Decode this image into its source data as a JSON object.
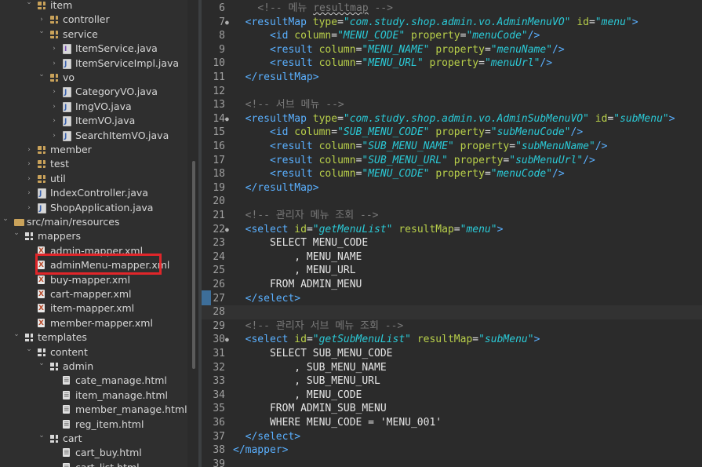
{
  "explorer": {
    "items": [
      {
        "label": "item",
        "icon": "package-icon",
        "depth": 3,
        "state": "expanded"
      },
      {
        "label": "controller",
        "icon": "package-icon",
        "depth": 4,
        "state": "collapsed"
      },
      {
        "label": "service",
        "icon": "package-icon",
        "depth": 4,
        "state": "expanded"
      },
      {
        "label": "ItemService.java",
        "icon": "java-interface-icon",
        "depth": 5,
        "state": "collapsed"
      },
      {
        "label": "ItemServiceImpl.java",
        "icon": "java-file-icon",
        "depth": 5,
        "state": "collapsed"
      },
      {
        "label": "vo",
        "icon": "package-icon",
        "depth": 4,
        "state": "expanded"
      },
      {
        "label": "CategoryVO.java",
        "icon": "java-file-icon",
        "depth": 5,
        "state": "collapsed"
      },
      {
        "label": "ImgVO.java",
        "icon": "java-file-icon",
        "depth": 5,
        "state": "collapsed"
      },
      {
        "label": "ItemVO.java",
        "icon": "java-file-icon",
        "depth": 5,
        "state": "collapsed"
      },
      {
        "label": "SearchItemVO.java",
        "icon": "java-file-icon",
        "depth": 5,
        "state": "collapsed"
      },
      {
        "label": "member",
        "icon": "package-icon",
        "depth": 3,
        "state": "collapsed"
      },
      {
        "label": "test",
        "icon": "package-icon",
        "depth": 3,
        "state": "collapsed"
      },
      {
        "label": "util",
        "icon": "package-icon",
        "depth": 3,
        "state": "collapsed"
      },
      {
        "label": "IndexController.java",
        "icon": "java-file-icon",
        "depth": 3,
        "state": "collapsed"
      },
      {
        "label": "ShopApplication.java",
        "icon": "java-file-icon",
        "depth": 3,
        "state": "collapsed"
      },
      {
        "label": "src/main/resources",
        "icon": "source-folder-icon",
        "depth": 1,
        "state": "expanded"
      },
      {
        "label": "mappers",
        "icon": "folder-icon",
        "depth": 2,
        "state": "expanded"
      },
      {
        "label": "admin-mapper.xml",
        "icon": "xml-file-icon",
        "depth": 3,
        "state": "leaf"
      },
      {
        "label": "adminMenu-mapper.xml",
        "icon": "xml-file-icon",
        "depth": 3,
        "state": "leaf",
        "highlighted": true
      },
      {
        "label": "buy-mapper.xml",
        "icon": "xml-file-icon",
        "depth": 3,
        "state": "leaf"
      },
      {
        "label": "cart-mapper.xml",
        "icon": "xml-file-icon",
        "depth": 3,
        "state": "leaf"
      },
      {
        "label": "item-mapper.xml",
        "icon": "xml-file-icon",
        "depth": 3,
        "state": "leaf"
      },
      {
        "label": "member-mapper.xml",
        "icon": "xml-file-icon",
        "depth": 3,
        "state": "leaf"
      },
      {
        "label": "templates",
        "icon": "folder-icon",
        "depth": 2,
        "state": "expanded"
      },
      {
        "label": "content",
        "icon": "folder-icon",
        "depth": 3,
        "state": "expanded"
      },
      {
        "label": "admin",
        "icon": "folder-icon",
        "depth": 4,
        "state": "expanded"
      },
      {
        "label": "cate_manage.html",
        "icon": "html-file-icon",
        "depth": 5,
        "state": "leaf"
      },
      {
        "label": "item_manage.html",
        "icon": "html-file-icon",
        "depth": 5,
        "state": "leaf"
      },
      {
        "label": "member_manage.html",
        "icon": "html-file-icon",
        "depth": 5,
        "state": "leaf"
      },
      {
        "label": "reg_item.html",
        "icon": "html-file-icon",
        "depth": 5,
        "state": "leaf"
      },
      {
        "label": "cart",
        "icon": "folder-icon",
        "depth": 4,
        "state": "expanded"
      },
      {
        "label": "cart_buy.html",
        "icon": "html-file-icon",
        "depth": 5,
        "state": "leaf"
      },
      {
        "label": "cart_list.html",
        "icon": "html-file-icon",
        "depth": 5,
        "state": "leaf"
      }
    ]
  },
  "editor": {
    "current_line": 28,
    "lines": [
      {
        "n": "6",
        "fold": "",
        "tokens": [
          [
            "    ",
            "txt"
          ],
          [
            "<!-- 메뉴 ",
            "com"
          ],
          [
            "resultmap",
            "com squig"
          ],
          [
            " -->",
            "com"
          ]
        ]
      },
      {
        "n": "7",
        "fold": "●",
        "tokens": [
          [
            "  ",
            "txt"
          ],
          [
            "<resultMap ",
            "tag"
          ],
          [
            "type",
            "attr"
          ],
          [
            "=",
            "txt"
          ],
          [
            "\"com.study.shop.admin.vo.AdminMenuVO\"",
            "str"
          ],
          [
            " ",
            "txt"
          ],
          [
            "id",
            "attr"
          ],
          [
            "=",
            "txt"
          ],
          [
            "\"menu\"",
            "str"
          ],
          [
            ">",
            "tag"
          ]
        ]
      },
      {
        "n": "8",
        "fold": "",
        "tokens": [
          [
            "      ",
            "txt"
          ],
          [
            "<id ",
            "tag"
          ],
          [
            "column",
            "attr"
          ],
          [
            "=",
            "txt"
          ],
          [
            "\"MENU_CODE\"",
            "str"
          ],
          [
            " ",
            "txt"
          ],
          [
            "property",
            "attr"
          ],
          [
            "=",
            "txt"
          ],
          [
            "\"menuCode\"",
            "str"
          ],
          [
            "/>",
            "tag"
          ]
        ]
      },
      {
        "n": "9",
        "fold": "",
        "tokens": [
          [
            "      ",
            "txt"
          ],
          [
            "<result ",
            "tag"
          ],
          [
            "column",
            "attr"
          ],
          [
            "=",
            "txt"
          ],
          [
            "\"MENU_NAME\"",
            "str"
          ],
          [
            " ",
            "txt"
          ],
          [
            "property",
            "attr"
          ],
          [
            "=",
            "txt"
          ],
          [
            "\"menuName\"",
            "str"
          ],
          [
            "/>",
            "tag"
          ]
        ]
      },
      {
        "n": "10",
        "fold": "",
        "tokens": [
          [
            "      ",
            "txt"
          ],
          [
            "<result ",
            "tag"
          ],
          [
            "column",
            "attr"
          ],
          [
            "=",
            "txt"
          ],
          [
            "\"MENU_URL\"",
            "str"
          ],
          [
            " ",
            "txt"
          ],
          [
            "property",
            "attr"
          ],
          [
            "=",
            "txt"
          ],
          [
            "\"menuUrl\"",
            "str"
          ],
          [
            "/>",
            "tag"
          ]
        ]
      },
      {
        "n": "11",
        "fold": "",
        "tokens": [
          [
            "  ",
            "txt"
          ],
          [
            "</resultMap>",
            "tag"
          ]
        ]
      },
      {
        "n": "12",
        "fold": "",
        "tokens": []
      },
      {
        "n": "13",
        "fold": "",
        "tokens": [
          [
            "  ",
            "txt"
          ],
          [
            "<!-- 서브 메뉴 -->",
            "com"
          ]
        ]
      },
      {
        "n": "14",
        "fold": "●",
        "tokens": [
          [
            "  ",
            "txt"
          ],
          [
            "<resultMap ",
            "tag"
          ],
          [
            "type",
            "attr"
          ],
          [
            "=",
            "txt"
          ],
          [
            "\"com.study.shop.admin.vo.AdminSubMenuVO\"",
            "str"
          ],
          [
            " ",
            "txt"
          ],
          [
            "id",
            "attr"
          ],
          [
            "=",
            "txt"
          ],
          [
            "\"subMenu\"",
            "str"
          ],
          [
            ">",
            "tag"
          ]
        ]
      },
      {
        "n": "15",
        "fold": "",
        "tokens": [
          [
            "      ",
            "txt"
          ],
          [
            "<id ",
            "tag"
          ],
          [
            "column",
            "attr"
          ],
          [
            "=",
            "txt"
          ],
          [
            "\"SUB_MENU_CODE\"",
            "str"
          ],
          [
            " ",
            "txt"
          ],
          [
            "property",
            "attr"
          ],
          [
            "=",
            "txt"
          ],
          [
            "\"subMenuCode\"",
            "str"
          ],
          [
            "/>",
            "tag"
          ]
        ]
      },
      {
        "n": "16",
        "fold": "",
        "tokens": [
          [
            "      ",
            "txt"
          ],
          [
            "<result ",
            "tag"
          ],
          [
            "column",
            "attr"
          ],
          [
            "=",
            "txt"
          ],
          [
            "\"SUB_MENU_NAME\"",
            "str"
          ],
          [
            " ",
            "txt"
          ],
          [
            "property",
            "attr"
          ],
          [
            "=",
            "txt"
          ],
          [
            "\"subMenuName\"",
            "str"
          ],
          [
            "/>",
            "tag"
          ]
        ]
      },
      {
        "n": "17",
        "fold": "",
        "tokens": [
          [
            "      ",
            "txt"
          ],
          [
            "<result ",
            "tag"
          ],
          [
            "column",
            "attr"
          ],
          [
            "=",
            "txt"
          ],
          [
            "\"SUB_MENU_URL\"",
            "str"
          ],
          [
            " ",
            "txt"
          ],
          [
            "property",
            "attr"
          ],
          [
            "=",
            "txt"
          ],
          [
            "\"subMenuUrl\"",
            "str"
          ],
          [
            "/>",
            "tag"
          ]
        ]
      },
      {
        "n": "18",
        "fold": "",
        "tokens": [
          [
            "      ",
            "txt"
          ],
          [
            "<result ",
            "tag"
          ],
          [
            "column",
            "attr"
          ],
          [
            "=",
            "txt"
          ],
          [
            "\"MENU_CODE\"",
            "str"
          ],
          [
            " ",
            "txt"
          ],
          [
            "property",
            "attr"
          ],
          [
            "=",
            "txt"
          ],
          [
            "\"menuCode\"",
            "str"
          ],
          [
            "/>",
            "tag"
          ]
        ]
      },
      {
        "n": "19",
        "fold": "",
        "tokens": [
          [
            "  ",
            "txt"
          ],
          [
            "</resultMap>",
            "tag"
          ]
        ]
      },
      {
        "n": "20",
        "fold": "",
        "tokens": []
      },
      {
        "n": "21",
        "fold": "",
        "tokens": [
          [
            "  ",
            "txt"
          ],
          [
            "<!-- 관리자 메뉴 조회 -->",
            "com"
          ]
        ]
      },
      {
        "n": "22",
        "fold": "●",
        "tokens": [
          [
            "  ",
            "txt"
          ],
          [
            "<select ",
            "tag"
          ],
          [
            "id",
            "attr"
          ],
          [
            "=",
            "txt"
          ],
          [
            "\"getMenuList\"",
            "str"
          ],
          [
            " ",
            "txt"
          ],
          [
            "resultMap",
            "attr"
          ],
          [
            "=",
            "txt"
          ],
          [
            "\"menu\"",
            "str"
          ],
          [
            ">",
            "tag"
          ]
        ]
      },
      {
        "n": "23",
        "fold": "",
        "tokens": [
          [
            "      SELECT MENU_CODE",
            "txt"
          ]
        ]
      },
      {
        "n": "24",
        "fold": "",
        "tokens": [
          [
            "          , MENU_NAME",
            "txt"
          ]
        ]
      },
      {
        "n": "25",
        "fold": "",
        "tokens": [
          [
            "          , MENU_URL",
            "txt"
          ]
        ]
      },
      {
        "n": "26",
        "fold": "",
        "tokens": [
          [
            "      FROM ADMIN_MENU",
            "txt"
          ]
        ]
      },
      {
        "n": "27",
        "fold": "",
        "tokens": [
          [
            "  ",
            "txt"
          ],
          [
            "</select>",
            "tag"
          ]
        ]
      },
      {
        "n": "28",
        "fold": "",
        "tokens": []
      },
      {
        "n": "29",
        "fold": "",
        "tokens": [
          [
            "  ",
            "txt"
          ],
          [
            "<!-- 관리자 서브 메뉴 조회 -->",
            "com"
          ]
        ]
      },
      {
        "n": "30",
        "fold": "●",
        "tokens": [
          [
            "  ",
            "txt"
          ],
          [
            "<select ",
            "tag"
          ],
          [
            "id",
            "attr"
          ],
          [
            "=",
            "txt"
          ],
          [
            "\"getSubMenuList\"",
            "str"
          ],
          [
            " ",
            "txt"
          ],
          [
            "resultMap",
            "attr"
          ],
          [
            "=",
            "txt"
          ],
          [
            "\"subMenu\"",
            "str"
          ],
          [
            ">",
            "tag"
          ]
        ]
      },
      {
        "n": "31",
        "fold": "",
        "tokens": [
          [
            "      SELECT SUB_MENU_CODE",
            "txt"
          ]
        ]
      },
      {
        "n": "32",
        "fold": "",
        "tokens": [
          [
            "          , SUB_MENU_NAME",
            "txt"
          ]
        ]
      },
      {
        "n": "33",
        "fold": "",
        "tokens": [
          [
            "          , SUB_MENU_URL",
            "txt"
          ]
        ]
      },
      {
        "n": "34",
        "fold": "",
        "tokens": [
          [
            "          , MENU_CODE",
            "txt"
          ]
        ]
      },
      {
        "n": "35",
        "fold": "",
        "tokens": [
          [
            "      FROM ADMIN_SUB_MENU",
            "txt"
          ]
        ]
      },
      {
        "n": "36",
        "fold": "",
        "tokens": [
          [
            "      WHERE MENU_CODE = 'MENU_001'",
            "txt"
          ]
        ]
      },
      {
        "n": "37",
        "fold": "",
        "tokens": [
          [
            "  ",
            "txt"
          ],
          [
            "</select>",
            "tag"
          ]
        ]
      },
      {
        "n": "38",
        "fold": "",
        "tokens": [
          [
            "</mapper>",
            "tag"
          ]
        ]
      },
      {
        "n": "39",
        "fold": "",
        "tokens": []
      }
    ]
  },
  "colors": {
    "highlight_box": "#e0262a",
    "tag": "#5ab0ff",
    "attribute": "#b9d04a",
    "string": "#2bc9d6",
    "comment": "#7a7a7a"
  }
}
